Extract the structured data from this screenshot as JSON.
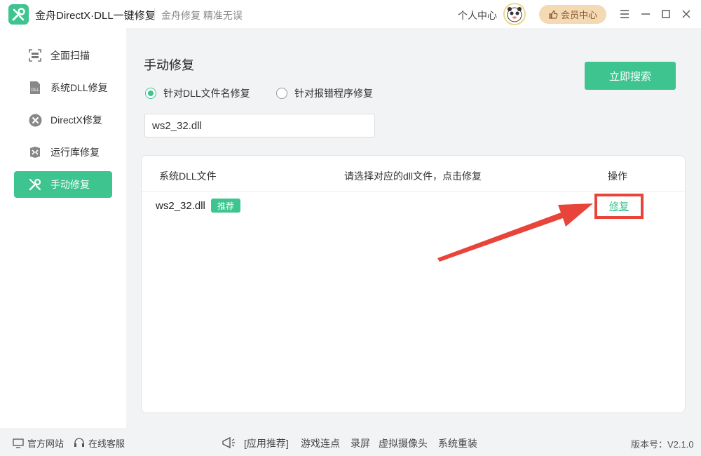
{
  "window": {
    "title": "金舟DirectX·DLL一键修复",
    "slogan": "金舟修复 精准无误",
    "personal_center": "个人中心",
    "member_center": "会员中心"
  },
  "sidebar": {
    "items": [
      {
        "label": "全面扫描",
        "icon": "scan-icon"
      },
      {
        "label": "系统DLL修复",
        "icon": "dll-icon"
      },
      {
        "label": "DirectX修复",
        "icon": "directx-icon"
      },
      {
        "label": "运行库修复",
        "icon": "runtime-icon"
      },
      {
        "label": "手动修复",
        "icon": "wrench-icon",
        "active": true
      }
    ]
  },
  "main": {
    "title": "手动修复",
    "search_button": "立即搜索",
    "radio_options": [
      {
        "label": "针对DLL文件名修复",
        "checked": true
      },
      {
        "label": "针对报错程序修复",
        "checked": false
      }
    ],
    "input_value": "ws2_32.dll",
    "table": {
      "headers": [
        "系统DLL文件",
        "请选择对应的dll文件，点击修复",
        "操作"
      ],
      "rows": [
        {
          "file": "ws2_32.dll",
          "badge": "推荐",
          "action": "修复"
        }
      ]
    }
  },
  "footer": {
    "official_site": "官方网站",
    "online_service": "在线客服",
    "app_recommend": "[应用推荐]",
    "links": [
      "游戏连点",
      "录屏",
      "虚拟摄像头",
      "系统重装"
    ],
    "version": "版本号：V2.1.0"
  },
  "colors": {
    "accent": "#3dc48f",
    "highlight_box": "#e8443a",
    "member_bg": "#f4d9b5"
  }
}
